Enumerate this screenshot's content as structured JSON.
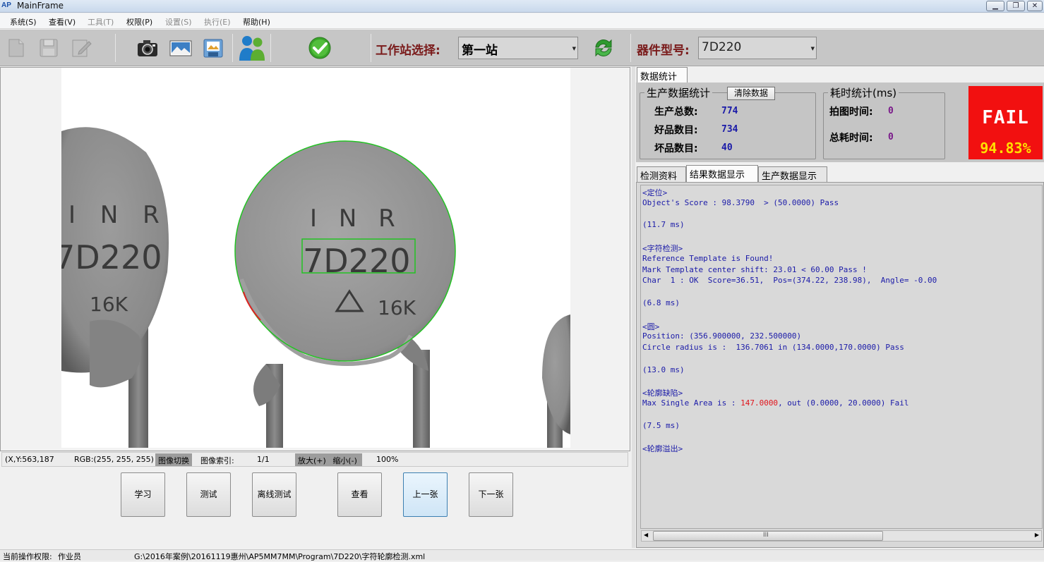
{
  "window": {
    "logo": "AP",
    "title": "MainFrame"
  },
  "menu": [
    {
      "label": "系统(S)",
      "enabled": true
    },
    {
      "label": "查看(V)",
      "enabled": true
    },
    {
      "label": "工具(T)",
      "enabled": false
    },
    {
      "label": "权限(P)",
      "enabled": true
    },
    {
      "label": "设置(S)",
      "enabled": false
    },
    {
      "label": "执行(E)",
      "enabled": false
    },
    {
      "label": "帮助(H)",
      "enabled": true
    }
  ],
  "toolbar": {
    "station_label": "工作站选择:",
    "station_value": "第一站",
    "part_label": "器件型号:",
    "part_value": "7D220"
  },
  "image_status": {
    "coords": "(X,Y:563,187",
    "rgb": "RGB:(255, 255, 255)",
    "switch_btn": "图像切换",
    "index_label": "图像索引:",
    "index_value": "1/1",
    "zoom_in": "放大(+)",
    "zoom_out": "缩小(-)",
    "zoom_value": "100%"
  },
  "image": {
    "part_left": [
      "I N R",
      "7D220",
      "16K"
    ],
    "part_center": [
      "I N R",
      "7D220",
      "16K"
    ]
  },
  "actions": {
    "learn": "学习",
    "test": "测试",
    "offline_test": "离线测试",
    "view": "查看",
    "prev": "上一张",
    "next": "下一张"
  },
  "right_top_tab": "数据统计",
  "production": {
    "title": "生产数据统计",
    "clear_btn": "清除数据",
    "total_label": "生产总数:",
    "total_value": "774",
    "good_label": "好品数目:",
    "good_value": "734",
    "bad_label": "坏品数目:",
    "bad_value": "40"
  },
  "timing": {
    "title": "耗时统计(ms)",
    "capture_label": "拍图时间:",
    "capture_value": "0",
    "total_label": "总耗时间:",
    "total_value": "0"
  },
  "result": {
    "status": "FAIL",
    "yield": "94.83%"
  },
  "result_tabs": [
    "检测资料",
    "结果数据显示",
    "生产数据显示"
  ],
  "log_lines": [
    "<定位>",
    "Object's Score : 98.3790  > (50.0000) Pass",
    "",
    "(11.7 ms)",
    "",
    "<字符检测>",
    "Reference Template is Found!",
    "Mark Template center shift: 23.01 < 60.00 Pass !",
    "Char  1 : OK  Score=36.51,  Pos=(374.22, 238.98),  Angle= -0.00",
    "",
    "(6.8 ms)",
    "",
    "<圆>",
    "Position: (356.900000, 232.500000)",
    "Circle radius is :  136.7061 in (134.0000,170.0000) Pass",
    "",
    "(13.0 ms)",
    "",
    "<轮廓缺陷>",
    "",
    "",
    "(7.5 ms)",
    "",
    "<轮廓溢出>"
  ],
  "log_defect": {
    "prefix": "Max Single Area is : ",
    "value": "147.0000",
    "suffix": ", out (0.0000, 20.0000) Fail"
  },
  "statusbar": {
    "permission_label": "当前操作权限:",
    "permission_value": "作业员",
    "path": "G:\\2016年案例\\20161119惠州\\AP5MM7MM\\Program\\7D220\\字符轮廓检测.xml"
  },
  "scroll_glyph": "III"
}
